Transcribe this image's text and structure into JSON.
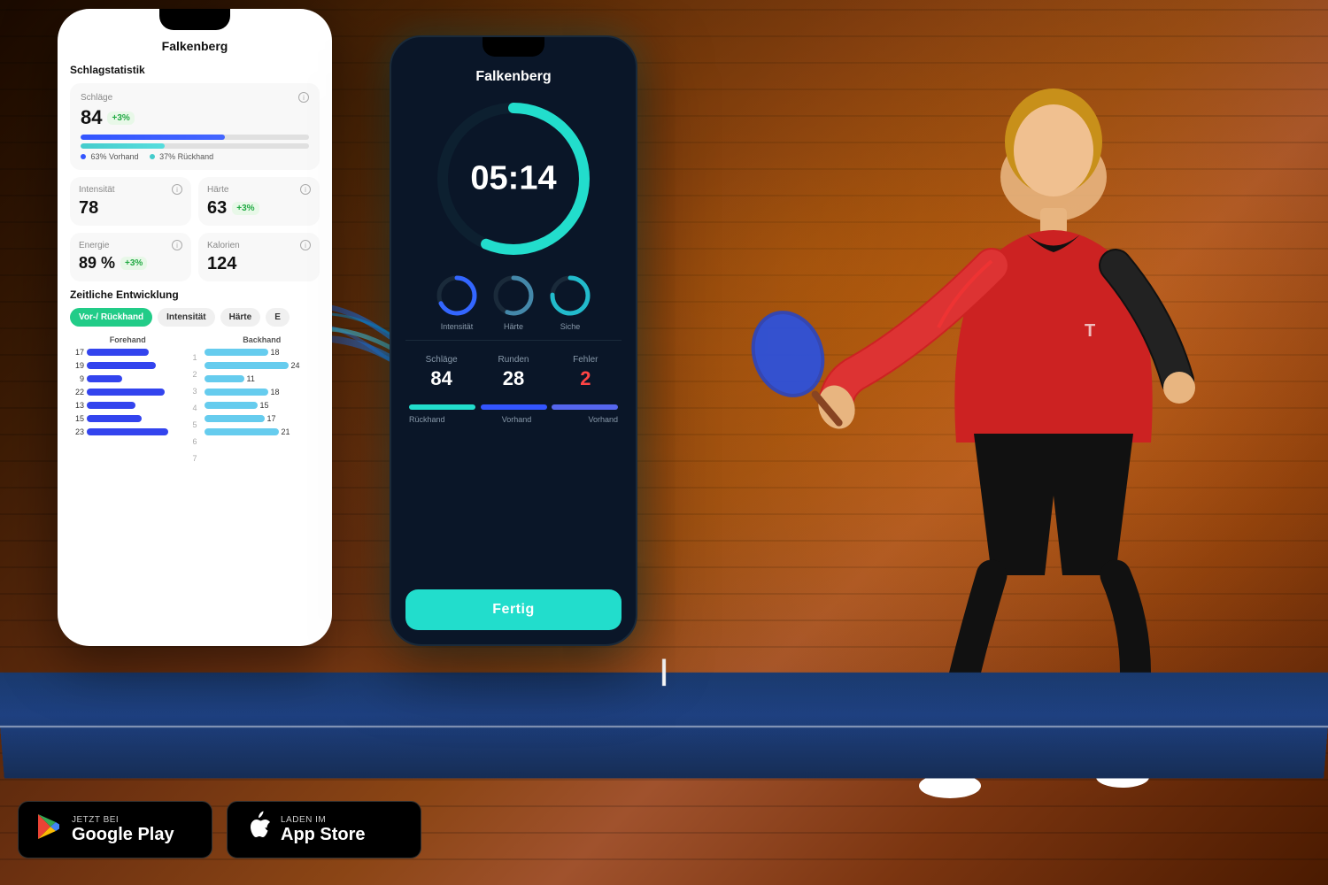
{
  "background": {
    "color": "#3a2010"
  },
  "phone_left": {
    "title": "Falkenberg",
    "schlagstatistik_label": "Schlagstatistik",
    "schlaege": {
      "label": "Schläge",
      "value": "84",
      "badge": "+3%",
      "bar_vorhand_pct": 63,
      "bar_rueckhand_pct": 37,
      "legend_vorhand": "63% Vorhand",
      "legend_rueckhand": "37% Rückhand"
    },
    "intensitaet": {
      "label": "Intensität",
      "value": "78"
    },
    "haerte": {
      "label": "Härte",
      "value": "63",
      "badge": "+3%"
    },
    "energie": {
      "label": "Energie",
      "value": "89 %",
      "badge": "+3%"
    },
    "kalorien": {
      "label": "Kalorien",
      "value": "124"
    },
    "zeitliche_label": "Zeitliche Entwicklung",
    "filter_tabs": [
      "Vor-/ Rückhand",
      "Intensität",
      "Härte",
      "E"
    ],
    "active_tab": 0,
    "forehand_label": "Forehand",
    "backhand_label": "Backhand",
    "bar_rows": [
      {
        "index": 1,
        "forehand": 17,
        "backhand": 18
      },
      {
        "index": 2,
        "forehand": 19,
        "backhand": 24
      },
      {
        "index": 3,
        "forehand": 9,
        "backhand": 11
      },
      {
        "index": 4,
        "forehand": 22,
        "backhand": 18
      },
      {
        "index": 5,
        "forehand": 13,
        "backhand": 15
      },
      {
        "index": 6,
        "forehand": 15,
        "backhand": 17
      },
      {
        "index": 7,
        "forehand": 23,
        "backhand": 21
      }
    ]
  },
  "phone_right": {
    "title": "Falkenberg",
    "time": "05:14",
    "mini_circles": [
      {
        "label": "Intensität"
      },
      {
        "label": "Härte"
      },
      {
        "label": "Siche"
      }
    ],
    "schlaege_label": "Schläge",
    "schlaege_value": "84",
    "runden_label": "Runden",
    "runden_value": "28",
    "fehler_label": "Fehler",
    "fehler_value": "2",
    "bar1_label": "Rückhand",
    "bar2_label": "Vorhand",
    "bar3_label": "Vorhand",
    "fertig_label": "Fertig"
  },
  "store_buttons": {
    "google_play": {
      "sub": "JETZT BEI",
      "name": "Google Play",
      "icon": "▶"
    },
    "app_store": {
      "sub": "Laden im",
      "name": "App Store",
      "icon": ""
    }
  }
}
